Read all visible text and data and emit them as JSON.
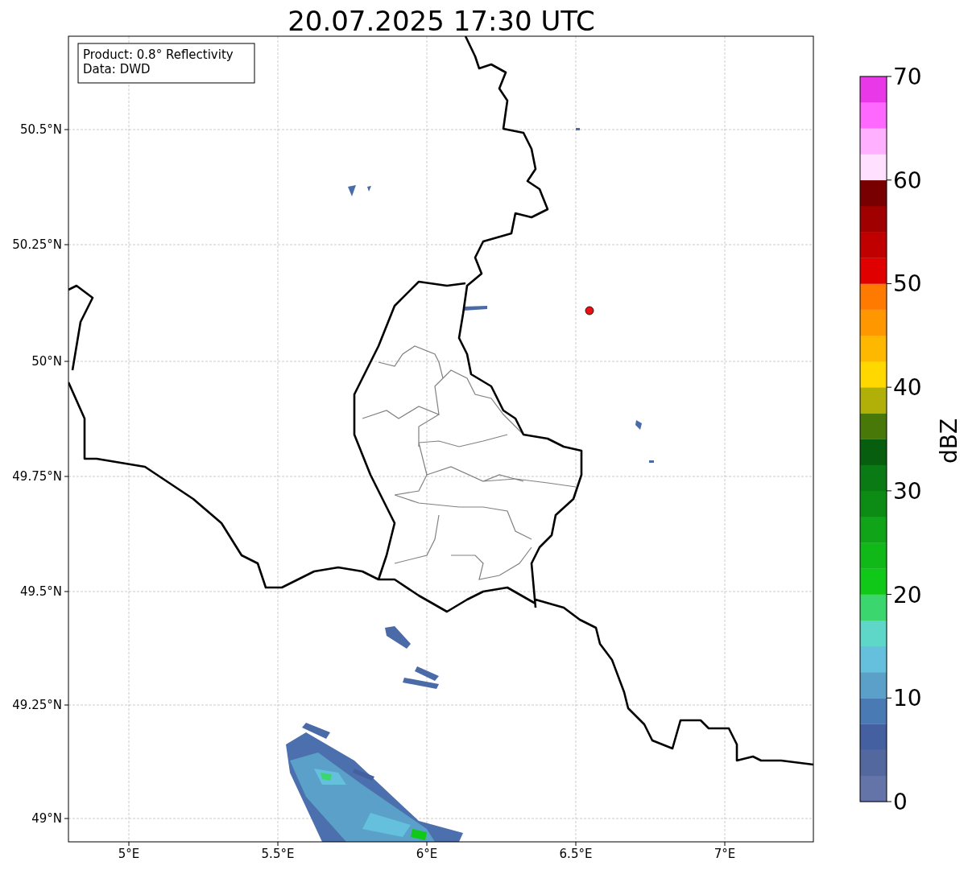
{
  "title": "20.07.2025 17:30 UTC",
  "legend": [
    "Product: 0.8° Reflectivity",
    "Data: DWD"
  ],
  "map": {
    "xticks": [
      "5°E",
      "5.5°E",
      "6°E",
      "6.5°E",
      "7°E"
    ],
    "yticks": [
      "50.5°N",
      "50.25°N",
      "50°N",
      "49.75°N",
      "49.5°N",
      "49.25°N",
      "49°N"
    ]
  },
  "colorbar": {
    "label": "dBZ",
    "ticks": [
      "70",
      "60",
      "50",
      "40",
      "30",
      "20",
      "10",
      "0"
    ],
    "bands": [
      {
        "color": "#6474a8"
      },
      {
        "color": "#5468a0"
      },
      {
        "color": "#4460a0"
      },
      {
        "color": "#4a7ab4"
      },
      {
        "color": "#5aa0c8"
      },
      {
        "color": "#64c0dc"
      },
      {
        "color": "#5ed6c8"
      },
      {
        "color": "#3cd66e"
      },
      {
        "color": "#10c818"
      },
      {
        "color": "#10b818"
      },
      {
        "color": "#10a418"
      },
      {
        "color": "#0c8c14"
      },
      {
        "color": "#0a7a14"
      },
      {
        "color": "#065e0e"
      },
      {
        "color": "#487808"
      },
      {
        "color": "#b0b008"
      },
      {
        "color": "#ffd800"
      },
      {
        "color": "#ffb800"
      },
      {
        "color": "#ff9800"
      },
      {
        "color": "#ff7a00"
      },
      {
        "color": "#e00000"
      },
      {
        "color": "#c00000"
      },
      {
        "color": "#a00000"
      },
      {
        "color": "#780000"
      },
      {
        "color": "#ffe0ff"
      },
      {
        "color": "#ffb0ff"
      },
      {
        "color": "#ff68ff"
      },
      {
        "color": "#e838e8"
      }
    ]
  }
}
